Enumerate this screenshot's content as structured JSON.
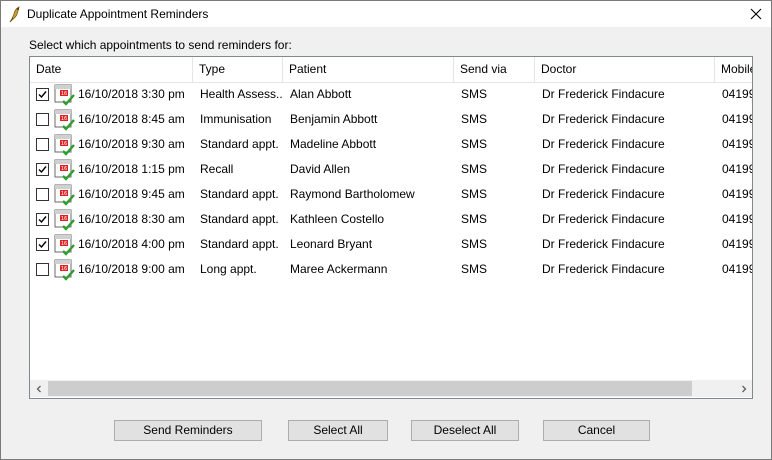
{
  "window": {
    "title": "Duplicate Appointment Reminders"
  },
  "prompt": "Select which appointments to send reminders for:",
  "columns": [
    "Date",
    "Type",
    "Patient",
    "Send via",
    "Doctor",
    "Mobile"
  ],
  "rows": [
    {
      "checked": true,
      "date": "16/10/2018 3:30 pm",
      "type": "Health Assess...",
      "patient": "Alan Abbott",
      "send_via": "SMS",
      "doctor": "Dr Frederick Findacure",
      "mobile": "04199"
    },
    {
      "checked": false,
      "date": "16/10/2018 8:45 am",
      "type": "Immunisation",
      "patient": "Benjamin Abbott",
      "send_via": "SMS",
      "doctor": "Dr Frederick Findacure",
      "mobile": "04199"
    },
    {
      "checked": false,
      "date": "16/10/2018 9:30 am",
      "type": "Standard appt.",
      "patient": "Madeline Abbott",
      "send_via": "SMS",
      "doctor": "Dr Frederick Findacure",
      "mobile": "04199"
    },
    {
      "checked": true,
      "date": "16/10/2018 1:15 pm",
      "type": "Recall",
      "patient": "David Allen",
      "send_via": "SMS",
      "doctor": "Dr Frederick Findacure",
      "mobile": "04199"
    },
    {
      "checked": false,
      "date": "16/10/2018 9:45 am",
      "type": "Standard appt.",
      "patient": "Raymond Bartholomew",
      "send_via": "SMS",
      "doctor": "Dr Frederick Findacure",
      "mobile": "04199"
    },
    {
      "checked": true,
      "date": "16/10/2018 8:30 am",
      "type": "Standard appt.",
      "patient": "Kathleen Costello",
      "send_via": "SMS",
      "doctor": "Dr Frederick Findacure",
      "mobile": "04199"
    },
    {
      "checked": true,
      "date": "16/10/2018 4:00 pm",
      "type": "Standard appt.",
      "patient": "Leonard Bryant",
      "send_via": "SMS",
      "doctor": "Dr Frederick Findacure",
      "mobile": "04199"
    },
    {
      "checked": false,
      "date": "16/10/2018 9:00 am",
      "type": "Long appt.",
      "patient": "Maree Ackermann",
      "send_via": "SMS",
      "doctor": "Dr Frederick Findacure",
      "mobile": "04199"
    }
  ],
  "icons": {
    "title": "bird-app-icon",
    "row": "calendar-check-icon",
    "close": "close-icon"
  },
  "buttons": {
    "send": "Send Reminders",
    "select_all": "Select All",
    "deselect_all": "Deselect All",
    "cancel": "Cancel"
  }
}
